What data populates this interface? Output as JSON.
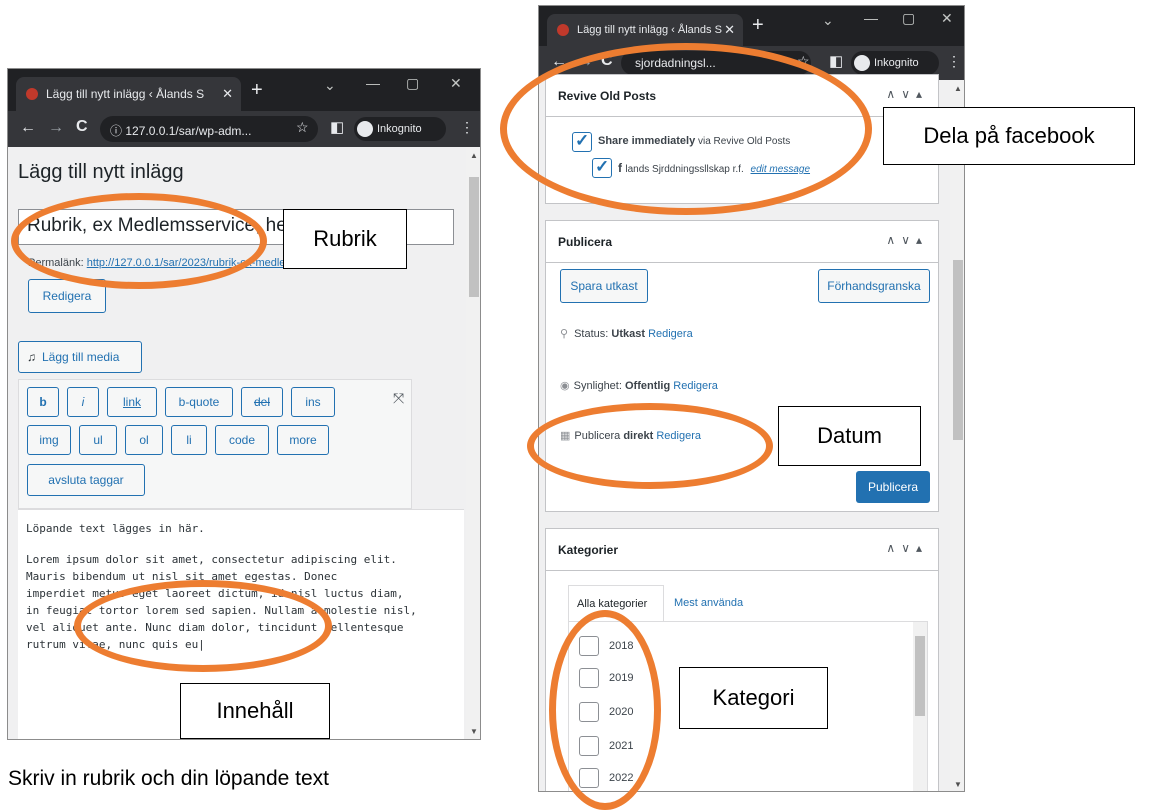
{
  "left_window": {
    "tab_title": "Lägg till nytt inlägg ‹ Ålands S",
    "url_text": "127.0.0.1/sar/wp-adm...",
    "incognito_label": "Inkognito",
    "page_title": "Lägg till nytt inlägg",
    "title_input_value": "Rubrik, ex Medlemsservice, hemtransport",
    "permalink_label": "Permalänk:",
    "permalink_url": "http://127.0.0.1/sar/2023/rubrik-ex-medlemsservice-hemtransport/",
    "edit_permalink_button": "Redigera",
    "add_media_button": "Lägg till media",
    "quicktags": [
      "b",
      "i",
      "link",
      "b-quote",
      "del",
      "ins",
      "img",
      "ul",
      "ol",
      "li",
      "code",
      "more",
      "avsluta taggar"
    ],
    "content_first_line": "Löpande text lägges in här.",
    "content_lines": [
      "Lorem ipsum dolor sit amet, consectetur adipiscing elit.",
      "Mauris bibendum ut nisl sit amet egestas. Donec",
      "imperdiet metus eget laoreet dictum, id nisl luctus diam,",
      "in feugiat tortor lorem sed sapien. Nullam a molestie nisl,",
      "vel aliquet ante. Nunc diam dolor, tincidunt pellentesque",
      "rutrum vitae, nunc quis eu|"
    ]
  },
  "right_window": {
    "tab_title": "Lägg till nytt inlägg ‹ Ålands S",
    "url_text": "sjordadningsl...",
    "incognito_label": "Inkognito",
    "revive_panel": {
      "title": "Revive Old Posts",
      "share_label_bold": "Share immediately",
      "share_label_rest": " via Revive Old Posts",
      "account_label": "lands Sjrddningssllskap r.f.",
      "edit_message": "edit message"
    },
    "publish_panel": {
      "title": "Publicera",
      "save_draft": "Spara utkast",
      "preview": "Förhandsgranska",
      "status_label": "Status:",
      "status_value": "Utkast",
      "visibility_label": "Synlighet:",
      "visibility_value": "Offentlig",
      "publish_label": "Publicera",
      "publish_value": "direkt",
      "edit_link": "Redigera",
      "publish_button": "Publicera"
    },
    "categories_panel": {
      "title": "Kategorier",
      "tab_all": "Alla kategorier",
      "tab_most_used": "Mest använda",
      "items": [
        "2018",
        "2019",
        "2020",
        "2021",
        "2022"
      ]
    }
  },
  "annotations": {
    "rubrik": "Rubrik",
    "innehall": "Innehåll",
    "dela": "Dela på facebook",
    "datum": "Datum",
    "kategori": "Kategori",
    "caption": "Skriv in rubrik och din löpande text"
  },
  "colors": {
    "annotation_ring": "#ed7d31",
    "wp_blue": "#2271b1",
    "chrome_dark": "#202124",
    "chrome_toolbar": "#35363a"
  }
}
